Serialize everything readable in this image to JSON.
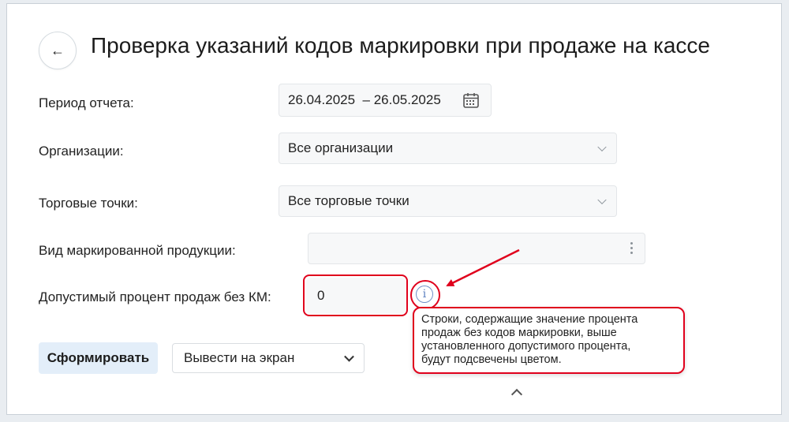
{
  "header": {
    "back_arrow": "←",
    "title": "Проверка указаний кодов маркировки при продаже на кассе"
  },
  "form": {
    "period": {
      "label": "Период отчета:",
      "value": "26.04.2025  – 26.05.2025"
    },
    "organizations": {
      "label": "Организации:",
      "value": "Все организации"
    },
    "outlets": {
      "label": "Торговые точки:",
      "value": "Все торговые точки"
    },
    "product_type": {
      "label": "Вид маркированной продукции:",
      "value": ""
    },
    "allowed_percent": {
      "label": "Допустимый процент продаж без КМ:",
      "value": "0"
    }
  },
  "info_icon_glyph": "i",
  "tooltip": {
    "text": "Строки, содержащие значение процента\nпродаж без кодов маркировки, выше\nустановленного допустимого процента,\nбудут подсвечены цветом."
  },
  "actions": {
    "generate_label": "Сформировать",
    "output_value": "Вывести на экран"
  },
  "icons": [
    "back-arrow-icon",
    "calendar-icon",
    "chevron-down-icon",
    "more-vertical-icon",
    "info-icon",
    "chevron-up-icon"
  ],
  "colors": {
    "highlight": "#e0001c",
    "primary_button_bg": "#e3eef9",
    "field_bg": "#f7f8f9",
    "info_icon": "#5a7fbf"
  }
}
